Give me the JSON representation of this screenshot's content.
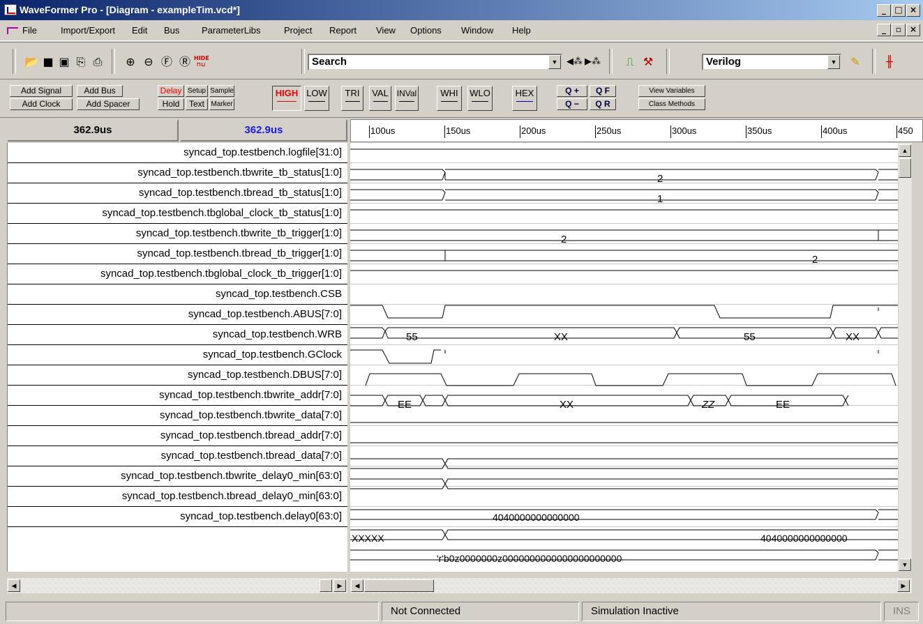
{
  "window": {
    "title": "WaveFormer Pro - [Diagram - exampleTim.vcd*]"
  },
  "menu": [
    "File",
    "Import/Export",
    "Edit",
    "Bus",
    "ParameterLibs",
    "Project",
    "Report",
    "View",
    "Options",
    "Window",
    "Help"
  ],
  "toolbar": {
    "search_value": "Search",
    "language_value": "Verilog",
    "hide_label": "HIDE"
  },
  "sigtools": {
    "add_signal": "Add Signal",
    "add_bus": "Add Bus",
    "add_clock": "Add Clock",
    "add_spacer": "Add Spacer",
    "delay": "Delay",
    "setup": "Setup",
    "sample": "Sample",
    "hold": "Hold",
    "text": "Text",
    "marker": "Marker",
    "high": "HIGH",
    "low": "LOW",
    "tri": "TRI",
    "val": "VAL",
    "inval": "INVal",
    "whi": "WHI",
    "wlo": "WLO",
    "hex": "HEX",
    "zoom_in": "Q +",
    "zoom_out": "Q −",
    "zoom_full": "Q F",
    "zoom_range": "Q R",
    "view_variables": "View Variables",
    "class_methods": "Class Methods"
  },
  "timeboxes": {
    "left": "362.9us",
    "right": "362.9us"
  },
  "ruler": {
    "ticks": [
      "100us",
      "150us",
      "200us",
      "250us",
      "300us",
      "350us",
      "400us",
      "450"
    ]
  },
  "signals": [
    "syncad_top.testbench.logfile[31:0]",
    "syncad_top.testbench.tbwrite_tb_status[1:0]",
    "syncad_top.testbench.tbread_tb_status[1:0]",
    "syncad_top.testbench.tbglobal_clock_tb_status[1:0]",
    "syncad_top.testbench.tbwrite_tb_trigger[1:0]",
    "syncad_top.testbench.tbread_tb_trigger[1:0]",
    "syncad_top.testbench.tbglobal_clock_tb_trigger[1:0]",
    "syncad_top.testbench.CSB",
    "syncad_top.testbench.ABUS[7:0]",
    "syncad_top.testbench.WRB",
    "syncad_top.testbench.GClock",
    "syncad_top.testbench.DBUS[7:0]",
    "syncad_top.testbench.tbwrite_addr[7:0]",
    "syncad_top.testbench.tbwrite_data[7:0]",
    "syncad_top.testbench.tbread_addr[7:0]",
    "syncad_top.testbench.tbread_data[7:0]",
    "syncad_top.testbench.tbwrite_delay0_min[63:0]",
    "syncad_top.testbench.tbread_delay0_min[63:0]",
    "syncad_top.testbench.delay0[63:0]"
  ],
  "wave_values": {
    "tbwrite_tb_status": "2",
    "tbread_tb_status": "1",
    "tbwrite_tb_trigger": "2",
    "tbread_tb_trigger": "2",
    "abus_1": "55",
    "abus_2": "XX",
    "abus_3": "55",
    "abus_4": "XX",
    "dbus_1": "EE",
    "dbus_2": "XX",
    "dbus_3": "ZZ",
    "dbus_4": "EE",
    "tbwrite_delay0_min": "4040000000000000",
    "tbread_delay0_min_a": "XXXXX",
    "tbread_delay0_min_b": "4040000000000000",
    "delay0": "'r'b0z0000000z0000000000000000000000"
  },
  "status": {
    "connection": "Not Connected",
    "simulation": "Simulation Inactive",
    "mode": "INS"
  }
}
